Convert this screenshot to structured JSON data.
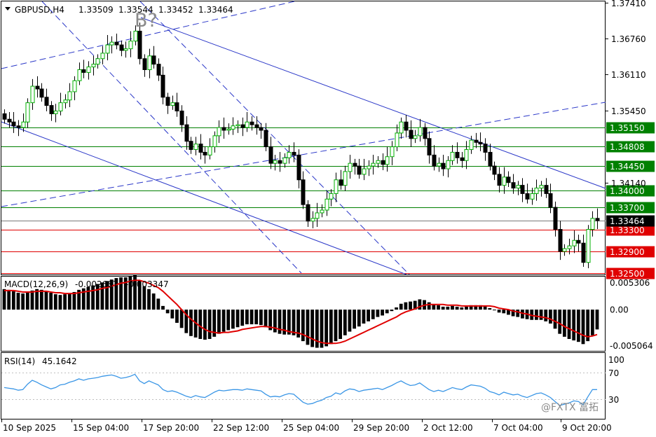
{
  "header": {
    "symbol": "GBPUSD,H4",
    "open": "1.33509",
    "high": "1.33544",
    "low": "1.33452",
    "close": "1.33464"
  },
  "annotation": "B?",
  "watermark": "@FXTX 富拓",
  "colors": {
    "bull": "#00b000",
    "bear": "#000000",
    "frame": "#000000",
    "green_level": "#008000",
    "red_level": "#e00000",
    "trend": "#2a37c8",
    "macd_signal": "#e00000",
    "rsi": "#3a96e6"
  },
  "chart_data": [
    {
      "type": "candlestick",
      "pane": "price",
      "title": "GBPUSD,H4",
      "ylim": [
        1.3248,
        1.3744
      ],
      "y_ticks": [
        "1.37410",
        "1.36760",
        "1.36110",
        "1.35450",
        "1.34140"
      ],
      "last_price": "1.33464",
      "levels": [
        {
          "value": 1.3515,
          "label": "1.35150",
          "color": "green"
        },
        {
          "value": 1.34808,
          "label": "1.34808",
          "color": "green"
        },
        {
          "value": 1.3445,
          "label": "1.34450",
          "color": "green"
        },
        {
          "value": 1.34,
          "label": "1.34000",
          "color": "green"
        },
        {
          "value": 1.337,
          "label": "1.33700",
          "color": "green"
        },
        {
          "value": 1.333,
          "label": "1.33300",
          "color": "red"
        },
        {
          "value": 1.329,
          "label": "1.32900",
          "color": "red"
        },
        {
          "value": 1.325,
          "label": "1.32500",
          "color": "red"
        }
      ],
      "x_labels": [
        "10 Sep 2025",
        "15 Sep 04:00",
        "17 Sep 20:00",
        "22 Sep 12:00",
        "25 Sep 04:00",
        "29 Sep 20:00",
        "2 Oct 12:00",
        "7 Oct 04:00",
        "9 Oct 20:00"
      ],
      "closes": [
        1.353,
        1.3525,
        1.3518,
        1.3515,
        1.3525,
        1.356,
        1.359,
        1.3585,
        1.357,
        1.3555,
        1.354,
        1.3545,
        1.356,
        1.3565,
        1.358,
        1.36,
        1.362,
        1.3615,
        1.3625,
        1.363,
        1.364,
        1.365,
        1.3665,
        1.367,
        1.3665,
        1.3655,
        1.3658,
        1.3672,
        1.369,
        1.364,
        1.362,
        1.3645,
        1.363,
        1.361,
        1.357,
        1.3555,
        1.356,
        1.3545,
        1.352,
        1.349,
        1.3475,
        1.3485,
        1.347,
        1.3465,
        1.348,
        1.35,
        1.3515,
        1.351,
        1.3512,
        1.3518,
        1.352,
        1.3515,
        1.3525,
        1.352,
        1.3515,
        1.351,
        1.348,
        1.345,
        1.3455,
        1.345,
        1.346,
        1.347,
        1.3465,
        1.342,
        1.3375,
        1.3345,
        1.335,
        1.336,
        1.3365,
        1.3385,
        1.3395,
        1.342,
        1.341,
        1.3435,
        1.345,
        1.3445,
        1.343,
        1.344,
        1.3445,
        1.345,
        1.3455,
        1.3448,
        1.3462,
        1.348,
        1.3505,
        1.3525,
        1.351,
        1.3495,
        1.35,
        1.3515,
        1.3495,
        1.3465,
        1.3445,
        1.345,
        1.344,
        1.3455,
        1.347,
        1.346,
        1.3455,
        1.3475,
        1.3492,
        1.3488,
        1.3485,
        1.347,
        1.3445,
        1.343,
        1.341,
        1.3425,
        1.3415,
        1.3405,
        1.341,
        1.3395,
        1.3385,
        1.3395,
        1.3405,
        1.341,
        1.3395,
        1.337,
        1.333,
        1.329,
        1.3295,
        1.33,
        1.331,
        1.3305,
        1.327,
        1.333,
        1.335,
        1.3346
      ],
      "opens": [
        1.354,
        1.353,
        1.3525,
        1.3518,
        1.3515,
        1.3525,
        1.356,
        1.359,
        1.3585,
        1.357,
        1.3555,
        1.354,
        1.3545,
        1.356,
        1.3565,
        1.358,
        1.36,
        1.362,
        1.3615,
        1.3625,
        1.363,
        1.364,
        1.365,
        1.3665,
        1.367,
        1.3665,
        1.3655,
        1.3658,
        1.3672,
        1.369,
        1.364,
        1.362,
        1.3645,
        1.363,
        1.361,
        1.357,
        1.3555,
        1.356,
        1.3545,
        1.352,
        1.349,
        1.3475,
        1.3485,
        1.347,
        1.3465,
        1.348,
        1.35,
        1.3515,
        1.351,
        1.3512,
        1.3518,
        1.352,
        1.3515,
        1.3525,
        1.352,
        1.3515,
        1.351,
        1.348,
        1.345,
        1.3455,
        1.345,
        1.346,
        1.347,
        1.3465,
        1.342,
        1.3375,
        1.3345,
        1.335,
        1.336,
        1.3365,
        1.3385,
        1.3395,
        1.342,
        1.341,
        1.3435,
        1.345,
        1.3445,
        1.343,
        1.344,
        1.3445,
        1.345,
        1.3455,
        1.3448,
        1.3462,
        1.348,
        1.3505,
        1.3525,
        1.351,
        1.3495,
        1.35,
        1.3515,
        1.3495,
        1.3465,
        1.3445,
        1.345,
        1.344,
        1.3455,
        1.347,
        1.346,
        1.3455,
        1.3475,
        1.3492,
        1.3488,
        1.3485,
        1.347,
        1.3445,
        1.343,
        1.341,
        1.3425,
        1.3415,
        1.3405,
        1.341,
        1.3395,
        1.3385,
        1.3395,
        1.3405,
        1.341,
        1.3395,
        1.337,
        1.333,
        1.329,
        1.3295,
        1.33,
        1.331,
        1.3305,
        1.327,
        1.333,
        1.335
      ]
    },
    {
      "type": "histogram",
      "pane": "macd",
      "title": "MACD(12,26,9)",
      "value_main": "-0.002687",
      "value_signal": "-0.003347",
      "ylim": [
        -0.00572,
        0.0045
      ],
      "y_ticks": [
        "0.005306",
        "0.00",
        "-0.005064"
      ],
      "histogram": [
        0.0028,
        0.0027,
        0.0025,
        0.0023,
        0.0022,
        0.0023,
        0.0026,
        0.0028,
        0.0027,
        0.0025,
        0.0023,
        0.0021,
        0.002,
        0.0021,
        0.0022,
        0.0024,
        0.0027,
        0.0029,
        0.0031,
        0.0033,
        0.0035,
        0.0037,
        0.0039,
        0.0041,
        0.0043,
        0.0044,
        0.0044,
        0.0045,
        0.0047,
        0.004,
        0.0032,
        0.0028,
        0.0022,
        0.0015,
        0.0005,
        -0.0005,
        -0.0012,
        -0.0018,
        -0.0025,
        -0.0032,
        -0.0036,
        -0.0038,
        -0.004,
        -0.0041,
        -0.004,
        -0.0037,
        -0.0033,
        -0.003,
        -0.0028,
        -0.0026,
        -0.0024,
        -0.0022,
        -0.002,
        -0.002,
        -0.002,
        -0.0021,
        -0.0024,
        -0.0028,
        -0.0031,
        -0.0033,
        -0.0034,
        -0.0034,
        -0.0035,
        -0.0038,
        -0.0043,
        -0.0048,
        -0.0051,
        -0.0052,
        -0.0052,
        -0.005,
        -0.0047,
        -0.0043,
        -0.004,
        -0.0035,
        -0.003,
        -0.0026,
        -0.0023,
        -0.0019,
        -0.0016,
        -0.0013,
        -0.001,
        -0.0008,
        -0.0005,
        -0.0002,
        0.0003,
        0.0008,
        0.001,
        0.0011,
        0.0012,
        0.0014,
        0.0013,
        0.001,
        0.0007,
        0.0006,
        0.0004,
        0.0004,
        0.0005,
        0.0004,
        0.0003,
        0.0004,
        0.0006,
        0.0006,
        0.0006,
        0.0005,
        0.0002,
        -0.0001,
        -0.0004,
        -0.0005,
        -0.0007,
        -0.0009,
        -0.001,
        -0.0012,
        -0.0013,
        -0.0014,
        -0.0014,
        -0.0014,
        -0.0016,
        -0.0019,
        -0.0026,
        -0.0033,
        -0.0037,
        -0.004,
        -0.0042,
        -0.0044,
        -0.0047,
        -0.0043,
        -0.0035,
        -0.0027
      ],
      "signal": [
        0.0026,
        0.0026,
        0.0026,
        0.0025,
        0.0024,
        0.0024,
        0.0024,
        0.0025,
        0.0025,
        0.0025,
        0.0024,
        0.0023,
        0.0023,
        0.0022,
        0.0022,
        0.0022,
        0.0023,
        0.0024,
        0.0025,
        0.0026,
        0.0027,
        0.0029,
        0.003,
        0.0032,
        0.0034,
        0.0036,
        0.0037,
        0.0039,
        0.004,
        0.004,
        0.0038,
        0.0036,
        0.0033,
        0.003,
        0.0025,
        0.0019,
        0.0013,
        0.0007,
        0.0,
        -0.0007,
        -0.0013,
        -0.0018,
        -0.0023,
        -0.0027,
        -0.003,
        -0.0031,
        -0.0032,
        -0.0031,
        -0.0031,
        -0.003,
        -0.0029,
        -0.0027,
        -0.0026,
        -0.0025,
        -0.0024,
        -0.0023,
        -0.0023,
        -0.0024,
        -0.0025,
        -0.0027,
        -0.0028,
        -0.003,
        -0.0031,
        -0.0032,
        -0.0034,
        -0.0037,
        -0.004,
        -0.0043,
        -0.0045,
        -0.0046,
        -0.0046,
        -0.0046,
        -0.0045,
        -0.0043,
        -0.004,
        -0.0037,
        -0.0034,
        -0.0031,
        -0.0028,
        -0.0025,
        -0.0022,
        -0.0019,
        -0.0016,
        -0.0013,
        -0.001,
        -0.0006,
        -0.0003,
        -0.0001,
        0.0001,
        0.0004,
        0.0006,
        0.0007,
        0.0007,
        0.0007,
        0.0007,
        0.0006,
        0.0006,
        0.0006,
        0.0005,
        0.0005,
        0.0005,
        0.0005,
        0.0005,
        0.0005,
        0.0005,
        0.0004,
        0.0002,
        0.0001,
        0.0,
        -0.0002,
        -0.0003,
        -0.0005,
        -0.0006,
        -0.0008,
        -0.0009,
        -0.001,
        -0.0011,
        -0.0013,
        -0.0016,
        -0.0019,
        -0.0023,
        -0.0026,
        -0.0029,
        -0.0032,
        -0.0035,
        -0.0037,
        -0.0036,
        -0.0034
      ]
    },
    {
      "type": "line",
      "pane": "rsi",
      "title": "RSI(14)",
      "value": "45.1642",
      "ylim": [
        0,
        100
      ],
      "y_ticks": [
        "100",
        "70",
        "30"
      ],
      "values": [
        48,
        47,
        46,
        44,
        45,
        53,
        59,
        56,
        52,
        49,
        46,
        48,
        52,
        53,
        56,
        58,
        61,
        59,
        61,
        62,
        63,
        65,
        66,
        67,
        65,
        62,
        63,
        65,
        68,
        58,
        54,
        58,
        55,
        52,
        45,
        42,
        43,
        41,
        38,
        35,
        33,
        36,
        34,
        33,
        37,
        41,
        44,
        43,
        44,
        45,
        45,
        44,
        46,
        45,
        44,
        43,
        38,
        34,
        35,
        34,
        37,
        39,
        38,
        32,
        26,
        23,
        24,
        27,
        29,
        33,
        35,
        40,
        38,
        43,
        46,
        45,
        42,
        44,
        45,
        46,
        47,
        45,
        48,
        51,
        55,
        58,
        54,
        51,
        52,
        55,
        50,
        45,
        42,
        44,
        42,
        45,
        48,
        46,
        45,
        49,
        52,
        51,
        50,
        47,
        42,
        40,
        37,
        41,
        39,
        37,
        38,
        35,
        33,
        36,
        39,
        40,
        37,
        33,
        27,
        21,
        23,
        25,
        28,
        27,
        22,
        34,
        45,
        45
      ]
    }
  ]
}
